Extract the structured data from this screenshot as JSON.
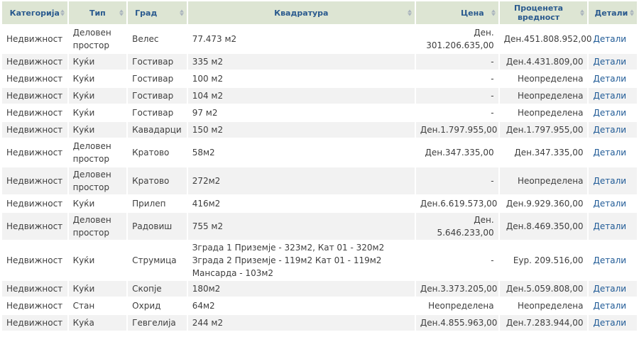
{
  "headers": {
    "category": "Категорија",
    "type": "Тип",
    "city": "Град",
    "area": "Квадратура",
    "price": "Цена",
    "estimated": "Проценета вредност",
    "details": "Детали"
  },
  "rows": [
    {
      "category": "Недвижност",
      "type": "Деловен простор",
      "city": "Велес",
      "area": "77.473 м2",
      "price": "Ден. 301.206.635,00",
      "estimated": "Ден.451.808.952,00",
      "details": "Детали"
    },
    {
      "category": "Недвижност",
      "type": "Куќи",
      "city": "Гостивар",
      "area": "335 м2",
      "price": "-",
      "estimated": "Ден.4.431.809,00",
      "details": "Детали"
    },
    {
      "category": "Недвижност",
      "type": "Куќи",
      "city": "Гостивар",
      "area": "100 м2",
      "price": "-",
      "estimated": "Неопределена",
      "details": "Детали"
    },
    {
      "category": "Недвижност",
      "type": "Куќи",
      "city": "Гостивар",
      "area": "104 м2",
      "price": "-",
      "estimated": "Неопределена",
      "details": "Детали"
    },
    {
      "category": "Недвижност",
      "type": "Куќи",
      "city": "Гостивар",
      "area": "97 м2",
      "price": "-",
      "estimated": "Неопределена",
      "details": "Детали"
    },
    {
      "category": "Недвижност",
      "type": "Куќи",
      "city": "Кавадарци",
      "area": "150 м2",
      "price": "Ден.1.797.955,00",
      "estimated": "Ден.1.797.955,00",
      "details": "Детали"
    },
    {
      "category": "Недвижност",
      "type": "Деловен простор",
      "city": "Кратово",
      "area": "58м2",
      "price": "Ден.347.335,00",
      "estimated": "Ден.347.335,00",
      "details": "Детали"
    },
    {
      "category": "Недвижност",
      "type": "Деловен простор",
      "city": "Кратово",
      "area": "272м2",
      "price": "-",
      "estimated": "Неопределена",
      "details": "Детали"
    },
    {
      "category": "Недвижност",
      "type": "Куќи",
      "city": "Прилеп",
      "area": "416м2",
      "price": "Ден.6.619.573,00",
      "estimated": "Ден.9.929.360,00",
      "details": "Детали"
    },
    {
      "category": "Недвижност",
      "type": "Деловен простор",
      "city": "Радовиш",
      "area": "755 м2",
      "price": "Ден. 5.646.233,00",
      "estimated": "Ден.8.469.350,00",
      "details": "Детали"
    },
    {
      "category": "Недвижност",
      "type": "Куќи",
      "city": "Струмица",
      "area": "Зграда 1 Приземје - 323м2, Кат 01 - 320м2 Зграда 2 Приземје - 119м2 Кат 01 - 119м2 Мансарда - 103м2",
      "price": "-",
      "estimated": "Еур. 209.516,00",
      "details": "Детали"
    },
    {
      "category": "Недвижност",
      "type": "Куќи",
      "city": "Скопје",
      "area": "180м2",
      "price": "Ден.3.373.205,00",
      "estimated": "Ден.5.059.808,00",
      "details": "Детали"
    },
    {
      "category": "Недвижност",
      "type": "Стан",
      "city": "Охрид",
      "area": "64м2",
      "price": "Неопределена",
      "estimated": "Неопределена",
      "details": "Детали"
    },
    {
      "category": "Недвижност",
      "type": "Куќа",
      "city": "Гевгелија",
      "area": "244 м2",
      "price": "Ден.4.855.963,00",
      "estimated": "Ден.7.283.944,00",
      "details": "Детали"
    }
  ]
}
